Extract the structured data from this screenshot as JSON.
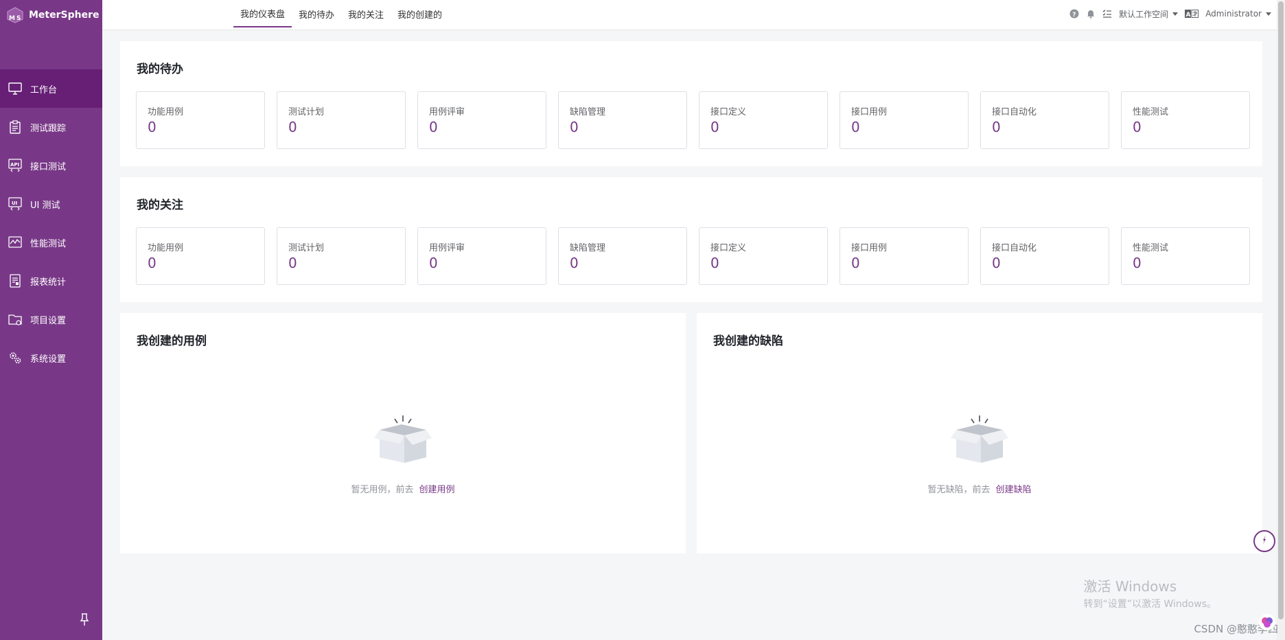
{
  "brand": {
    "name": "MeterSphere"
  },
  "sidebar": {
    "items": [
      {
        "label": "工作台",
        "icon": "monitor-icon"
      },
      {
        "label": "测试跟踪",
        "icon": "clipboard-icon"
      },
      {
        "label": "接口测试",
        "icon": "api-icon"
      },
      {
        "label": "UI 测试",
        "icon": "ui-icon"
      },
      {
        "label": "性能测试",
        "icon": "performance-chart-icon"
      },
      {
        "label": "报表统计",
        "icon": "report-icon"
      },
      {
        "label": "项目设置",
        "icon": "project-folder-icon"
      },
      {
        "label": "系统设置",
        "icon": "gears-icon"
      }
    ]
  },
  "header": {
    "tabs": [
      "我的仪表盘",
      "我的待办",
      "我的关注",
      "我的创建的"
    ],
    "workspace": "默认工作空间",
    "user": "Administrator"
  },
  "todo": {
    "title": "我的待办",
    "cards": [
      {
        "label": "功能用例",
        "value": "0"
      },
      {
        "label": "测试计划",
        "value": "0"
      },
      {
        "label": "用例评审",
        "value": "0"
      },
      {
        "label": "缺陷管理",
        "value": "0"
      },
      {
        "label": "接口定义",
        "value": "0"
      },
      {
        "label": "接口用例",
        "value": "0"
      },
      {
        "label": "接口自动化",
        "value": "0"
      },
      {
        "label": "性能测试",
        "value": "0"
      }
    ]
  },
  "follow": {
    "title": "我的关注",
    "cards": [
      {
        "label": "功能用例",
        "value": "0"
      },
      {
        "label": "测试计划",
        "value": "0"
      },
      {
        "label": "用例评审",
        "value": "0"
      },
      {
        "label": "缺陷管理",
        "value": "0"
      },
      {
        "label": "接口定义",
        "value": "0"
      },
      {
        "label": "接口用例",
        "value": "0"
      },
      {
        "label": "接口自动化",
        "value": "0"
      },
      {
        "label": "性能测试",
        "value": "0"
      }
    ]
  },
  "created_cases": {
    "title": "我创建的用例",
    "empty_text": "暂无用例，前去",
    "link": "创建用例"
  },
  "created_bugs": {
    "title": "我创建的缺陷",
    "empty_text": "暂无缺陷，前去",
    "link": "创建缺陷"
  },
  "watermark": {
    "line1": "激活 Windows",
    "line2": "转到“设置”以激活 Windows。",
    "csdn": "CSDN @憨憨李四"
  },
  "colors": {
    "accent": "#783887",
    "sidebar_active": "#661f75"
  }
}
